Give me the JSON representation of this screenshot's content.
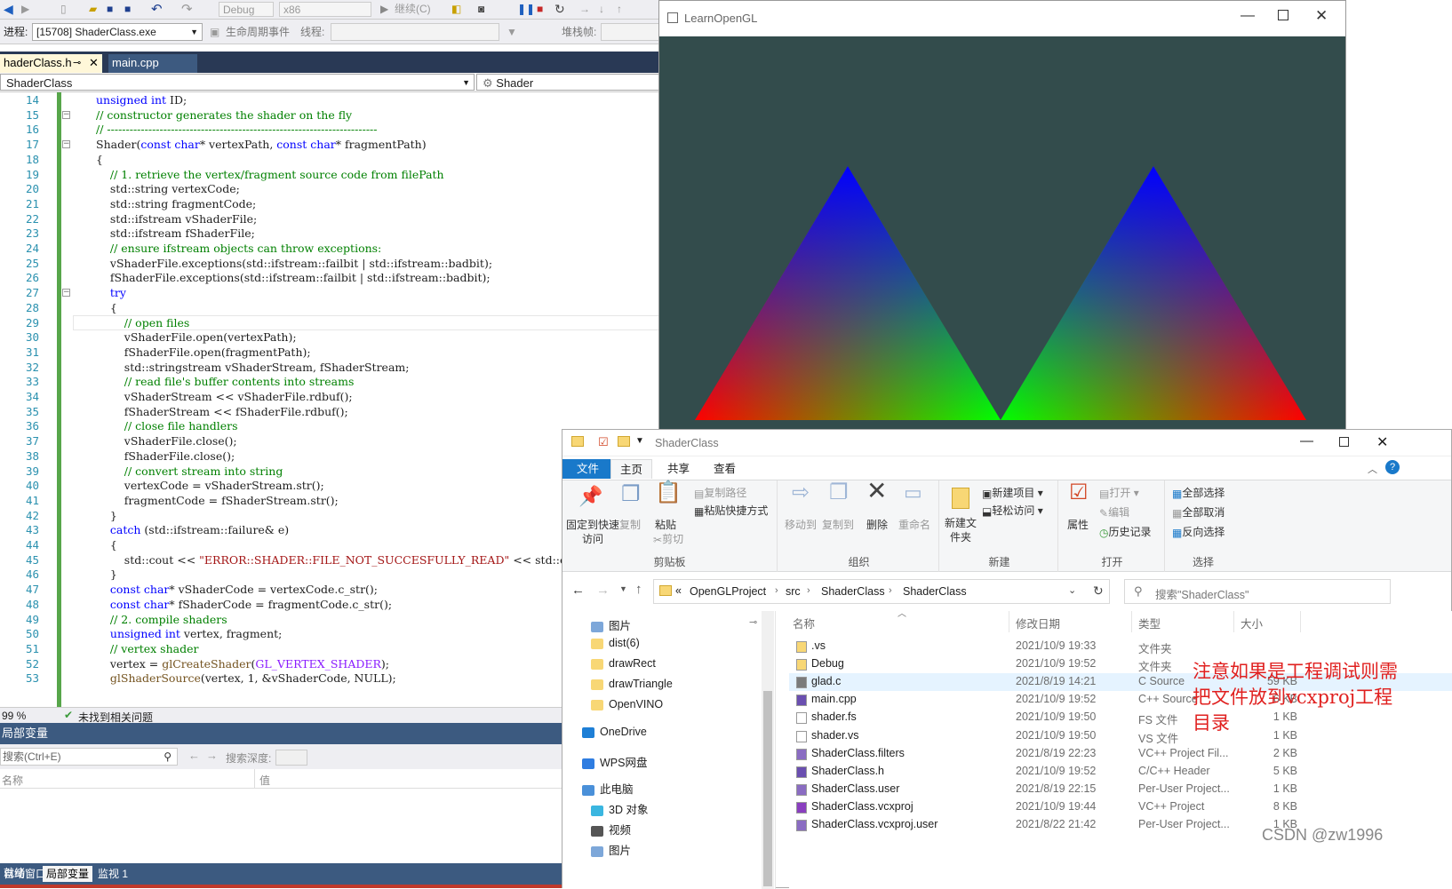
{
  "vs": {
    "toolbar": {
      "config": "Debug",
      "platform": "x86",
      "continue_label": "继续(C)"
    },
    "process_label": "进程:",
    "process_value": "[15708] ShaderClass.exe",
    "lifecycle_label": "生命周期事件",
    "thread_label": "线程:",
    "stackframe_label": "堆栈帧:",
    "tabs": [
      "haderClass.h",
      "main.cpp"
    ],
    "nav_scope": "ShaderClass",
    "nav_member": "Shader",
    "code_lines": [
      {
        "n": "14",
        "t": "unsigned int ID;"
      },
      {
        "n": "15",
        "t": "// constructor generates the shader on the fly"
      },
      {
        "n": "16",
        "t": "// ------------------------------------------------------------------------"
      },
      {
        "n": "17",
        "t": "Shader(const char* vertexPath, const char* fragmentPath)"
      },
      {
        "n": "18",
        "t": "{"
      },
      {
        "n": "19",
        "t": "    // 1. retrieve the vertex/fragment source code from filePath"
      },
      {
        "n": "20",
        "t": "    std::string vertexCode;"
      },
      {
        "n": "21",
        "t": "    std::string fragmentCode;"
      },
      {
        "n": "22",
        "t": "    std::ifstream vShaderFile;"
      },
      {
        "n": "23",
        "t": "    std::ifstream fShaderFile;"
      },
      {
        "n": "24",
        "t": "    // ensure ifstream objects can throw exceptions:"
      },
      {
        "n": "25",
        "t": "    vShaderFile.exceptions(std::ifstream::failbit | std::ifstream::badbit);"
      },
      {
        "n": "26",
        "t": "    fShaderFile.exceptions(std::ifstream::failbit | std::ifstream::badbit);"
      },
      {
        "n": "27",
        "t": "    try"
      },
      {
        "n": "28",
        "t": "    {"
      },
      {
        "n": "29",
        "t": "        // open files"
      },
      {
        "n": "30",
        "t": "        vShaderFile.open(vertexPath);"
      },
      {
        "n": "31",
        "t": "        fShaderFile.open(fragmentPath);"
      },
      {
        "n": "32",
        "t": "        std::stringstream vShaderStream, fShaderStream;"
      },
      {
        "n": "33",
        "t": "        // read file's buffer contents into streams"
      },
      {
        "n": "34",
        "t": "        vShaderStream << vShaderFile.rdbuf();"
      },
      {
        "n": "35",
        "t": "        fShaderStream << fShaderFile.rdbuf();"
      },
      {
        "n": "36",
        "t": "        // close file handlers"
      },
      {
        "n": "37",
        "t": "        vShaderFile.close();"
      },
      {
        "n": "38",
        "t": "        fShaderFile.close();"
      },
      {
        "n": "39",
        "t": "        // convert stream into string"
      },
      {
        "n": "40",
        "t": "        vertexCode = vShaderStream.str();"
      },
      {
        "n": "41",
        "t": "        fragmentCode = fShaderStream.str();"
      },
      {
        "n": "42",
        "t": "    }"
      },
      {
        "n": "43",
        "t": "    catch (std::ifstream::failure& e)"
      },
      {
        "n": "44",
        "t": "    {"
      },
      {
        "n": "45",
        "t": "        std::cout << \"ERROR::SHADER::FILE_NOT_SUCCESFULLY_READ\" << std::endl;"
      },
      {
        "n": "46",
        "t": "    }"
      },
      {
        "n": "47",
        "t": "    const char* vShaderCode = vertexCode.c_str();"
      },
      {
        "n": "48",
        "t": "    const char* fShaderCode = fragmentCode.c_str();"
      },
      {
        "n": "49",
        "t": "    // 2. compile shaders"
      },
      {
        "n": "50",
        "t": "    unsigned int vertex, fragment;"
      },
      {
        "n": "51",
        "t": "    // vertex shader"
      },
      {
        "n": "52",
        "t": "    vertex = glCreateShader(GL_VERTEX_SHADER);"
      },
      {
        "n": "53",
        "t": "    glShaderSource(vertex, 1, &vShaderCode, NULL);"
      }
    ],
    "zoom": "99 %",
    "issues": "未找到相关问题",
    "panel_title": "局部变量",
    "panel_search": "搜索(Ctrl+E)",
    "search_depth_label": "搜索深度:",
    "col_name": "名称",
    "col_value": "值",
    "bottom_tabs": [
      "自动窗口",
      "局部变量",
      "监视 1"
    ],
    "status": "就绪"
  },
  "gl": {
    "title": "LearnOpenGL",
    "bg": "#334c4c"
  },
  "explorer": {
    "title": "ShaderClass",
    "ribbon_tabs": [
      "文件",
      "主页",
      "共享",
      "查看"
    ],
    "groups": {
      "clipboard": {
        "caption": "剪贴板",
        "pin": "固定到快速访问",
        "copy": "复制",
        "paste": "粘贴",
        "copy_path": "复制路径",
        "paste_shortcut": "粘贴快捷方式",
        "cut": "剪切"
      },
      "organize": {
        "caption": "组织",
        "move_to": "移动到",
        "copy_to": "复制到",
        "delete": "删除",
        "rename": "重命名"
      },
      "new": {
        "caption": "新建",
        "new_folder": "新建文件夹",
        "new_item": "新建项目",
        "easy_access": "轻松访问"
      },
      "open": {
        "caption": "打开",
        "properties": "属性",
        "open": "打开",
        "edit": "编辑",
        "history": "历史记录"
      },
      "select": {
        "caption": "选择",
        "select_all": "全部选择",
        "select_none": "全部取消",
        "invert": "反向选择"
      }
    },
    "path": [
      "OpenGLProject",
      "src",
      "ShaderClass",
      "ShaderClass"
    ],
    "search_placeholder": "搜索\"ShaderClass\"",
    "nav_items": [
      "图片",
      "dist(6)",
      "drawRect",
      "drawTriangle",
      "OpenVINO",
      "OneDrive",
      "WPS网盘",
      "此电脑",
      "3D 对象",
      "视频",
      "图片"
    ],
    "columns": [
      "名称",
      "修改日期",
      "类型",
      "大小"
    ],
    "files": [
      {
        "name": ".vs",
        "date": "2021/10/9 19:33",
        "type": "文件夹",
        "size": "",
        "icon": "folder-icon"
      },
      {
        "name": "Debug",
        "date": "2021/10/9 19:52",
        "type": "文件夹",
        "size": "",
        "icon": "folder-icon"
      },
      {
        "name": "glad.c",
        "date": "2021/8/19 14:21",
        "type": "C Source",
        "size": "59 KB",
        "icon": "c-file-icon"
      },
      {
        "name": "main.cpp",
        "date": "2021/10/9 19:52",
        "type": "C++ Source",
        "size": "6 KB",
        "icon": "cpp-file-icon"
      },
      {
        "name": "shader.fs",
        "date": "2021/10/9 19:50",
        "type": "FS 文件",
        "size": "1 KB",
        "icon": "file-icon"
      },
      {
        "name": "shader.vs",
        "date": "2021/10/9 19:50",
        "type": "VS 文件",
        "size": "1 KB",
        "icon": "file-icon"
      },
      {
        "name": "ShaderClass.filters",
        "date": "2021/8/19 22:23",
        "type": "VC++ Project Fil...",
        "size": "2 KB",
        "icon": "project-file-icon"
      },
      {
        "name": "ShaderClass.h",
        "date": "2021/10/9 19:52",
        "type": "C/C++ Header",
        "size": "5 KB",
        "icon": "header-file-icon"
      },
      {
        "name": "ShaderClass.user",
        "date": "2021/8/19 22:15",
        "type": "Per-User Project...",
        "size": "1 KB",
        "icon": "user-file-icon"
      },
      {
        "name": "ShaderClass.vcxproj",
        "date": "2021/10/9 19:44",
        "type": "VC++ Project",
        "size": "8 KB",
        "icon": "vcxproj-icon"
      },
      {
        "name": "ShaderClass.vcxproj.user",
        "date": "2021/8/22 21:42",
        "type": "Per-User Project...",
        "size": "1 KB",
        "icon": "user-file-icon"
      }
    ]
  },
  "annotation": "注意如果是工程调试则需把文件放到vcxproj工程目录",
  "watermark": "CSDN @zw1996"
}
